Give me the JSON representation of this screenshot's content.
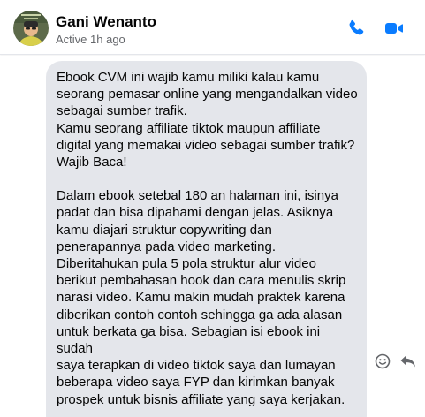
{
  "header": {
    "contact_name": "Gani Wenanto",
    "status": "Active 1h ago",
    "avatar_icon": "profile-photo",
    "call_icon": "phone-icon",
    "video_icon": "video-camera-icon",
    "accent_color": "#0a7cff"
  },
  "message": {
    "paragraph_1": "Ebook CVM ini wajib kamu miliki kalau kamu\nseorang pemasar online yang mengandalkan video\nsebagai sumber trafik.\nKamu seorang affiliate tiktok maupun affiliate\ndigital yang memakai video sebagai sumber trafik?\nWajib Baca!",
    "paragraph_2": "Dalam ebook setebal 180 an halaman ini, isinya\npadat dan bisa dipahami dengan jelas. Asiknya\nkamu diajari struktur copywriting dan\npenerapannya pada video marketing.\nDiberitahukan pula 5 pola struktur alur video\nberikut pembahasan hook dan cara menulis skrip\nnarasi video. Kamu makin mudah praktek karena\ndiberikan contoh contoh sehingga ga ada alasan\nuntuk berkata ga bisa. Sebagian isi ebook ini sudah\nsaya terapkan di video tiktok saya dan lumayan\nbeberapa video saya FYP dan kirimkan banyak\nprospek untuk bisnis affiliate yang saya kerjakan.",
    "bubble_color": "#e4e6eb",
    "react_icon": "smiley-icon",
    "reply_icon": "reply-arrow-icon"
  }
}
